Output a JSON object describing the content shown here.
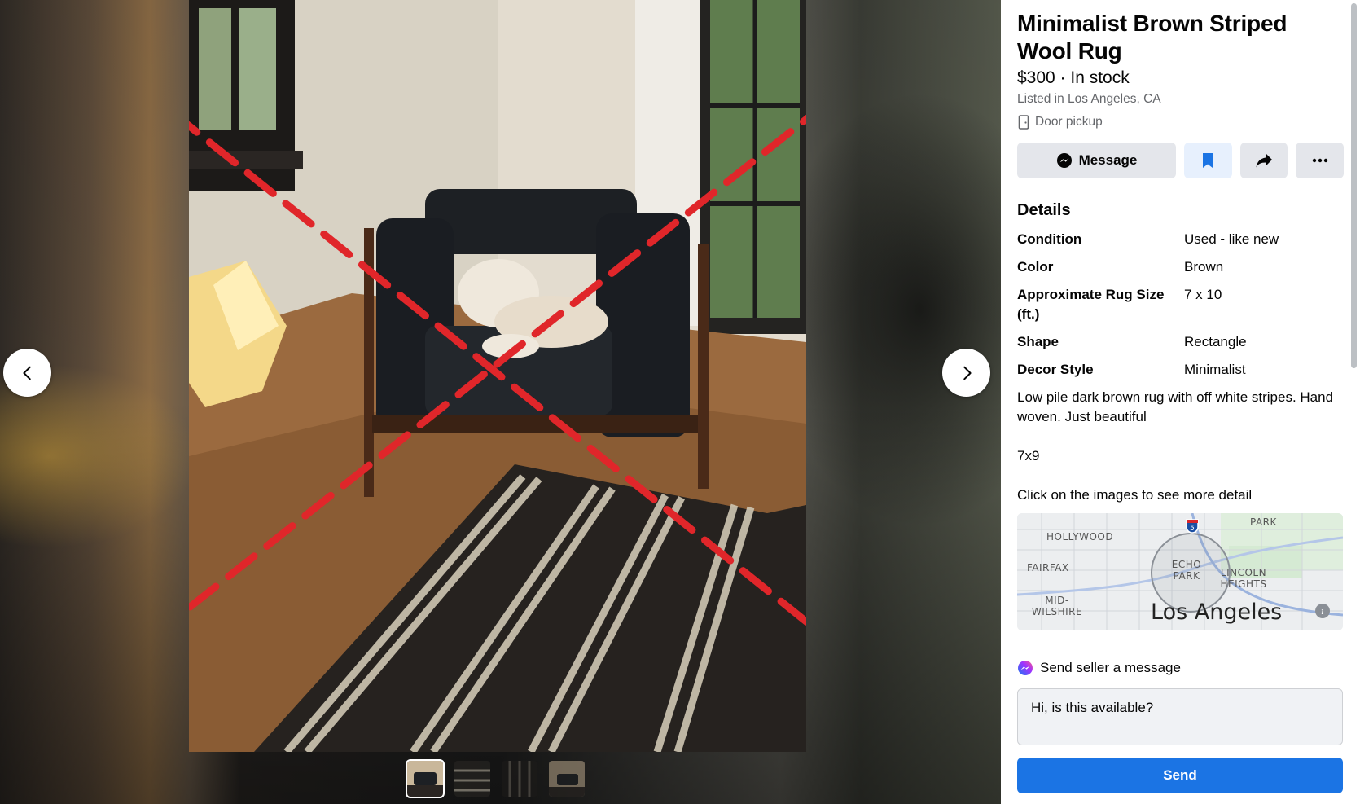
{
  "listing": {
    "title": "Minimalist Brown Striped Wool Rug",
    "price_line": "$300 · In stock",
    "location": "Listed in Los Angeles, CA",
    "pickup": "Door pickup"
  },
  "actions": {
    "message_label": "Message",
    "save_icon": "bookmark-icon",
    "share_icon": "share-icon",
    "more_icon": "more-icon"
  },
  "details": {
    "heading": "Details",
    "rows": [
      {
        "key": "Condition",
        "value": "Used - like new"
      },
      {
        "key": "Color",
        "value": "Brown"
      },
      {
        "key": "Approximate Rug Size (ft.)",
        "value": "7 x 10"
      },
      {
        "key": "Shape",
        "value": "Rectangle"
      },
      {
        "key": "Decor Style",
        "value": "Minimalist"
      }
    ],
    "description": [
      "Low pile dark brown rug with off white stripes. Hand woven. Just beautiful",
      "7x9",
      "Click on the images to see more detail"
    ]
  },
  "map": {
    "labels": [
      "HOLLYWOOD",
      "PARK",
      "FAIRFAX",
      "ECHO PARK",
      "LINCOLN HEIGHTS",
      "MID- WILSHIRE"
    ],
    "city": "Los Angeles",
    "highway_shield": "5"
  },
  "composer": {
    "heading": "Send seller a message",
    "message_value": "Hi, is this available?",
    "send_label": "Send"
  },
  "gallery": {
    "thumbnail_count": 4,
    "active_thumbnail": 1
  },
  "colors": {
    "primary": "#1b74e4",
    "button_gray": "#e4e6eb",
    "text_secondary": "#65676b",
    "cross_mark": "#e0262a"
  }
}
